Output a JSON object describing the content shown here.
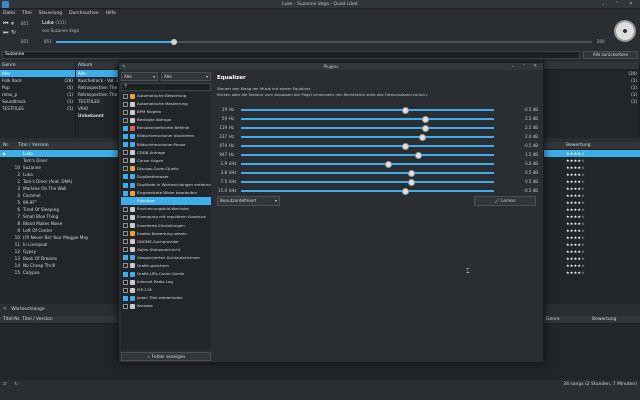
{
  "window": {
    "title": "Luke - Suzanne Vega - Quod Libet"
  },
  "menu": [
    "Datei",
    "Titel",
    "Steuerung",
    "Durchsuchen",
    "Hilfe"
  ],
  "player": {
    "volume_label": "851",
    "volume_value": "851",
    "title": "Luka",
    "title_extra": "(351)",
    "artist": "von Suzanne Vega",
    "time_current": "851",
    "time_total": "200",
    "progress": 0.22
  },
  "search": {
    "value": "Suzanne",
    "button_label": "Alle zurücksetzen"
  },
  "browser": {
    "genre_header": "Genre",
    "genres": [
      {
        "label": "Alle",
        "count": "",
        "selected": true
      },
      {
        "label": "Folk Rock",
        "count": "(28)"
      },
      {
        "label": "Pop",
        "count": "(5)"
      },
      {
        "label": "relax_p",
        "count": "(1)"
      },
      {
        "label": "Soundtrack",
        "count": "(1)"
      },
      {
        "label": "TESTFILES",
        "count": "(1)"
      }
    ],
    "album_header": "Album",
    "albums": [
      {
        "label": "Alle",
        "selected": true
      },
      {
        "label": "Kuschelrock - Vol. 23"
      },
      {
        "label": "Retrospective: The B"
      },
      {
        "label": "Retrospective: The B"
      },
      {
        "label": "TESTFILES"
      },
      {
        "label": "VAIO"
      },
      {
        "label": "Unbekannt",
        "bold": true
      }
    ],
    "right_counts": [
      "(30)",
      "(1)",
      "(1)",
      "(1)",
      "(1)"
    ]
  },
  "tracks": {
    "header_num": "Nr.",
    "header_title": "Titel / Version",
    "header_rating": "Bewertung",
    "rows": [
      {
        "num": "",
        "title": "Luka",
        "stars": "★★★★☆",
        "selected": true,
        "playing": true
      },
      {
        "num": "",
        "title": "Tom's Diner",
        "stars": "★★★★☆"
      },
      {
        "num": "10",
        "title": "Suzanne",
        "stars": "★★★★☆"
      },
      {
        "num": "2",
        "title": "Luka",
        "stars": "★★★★☆"
      },
      {
        "num": "2",
        "title": "Tom's Diner (feat. DNA)",
        "stars": "★★★★☆"
      },
      {
        "num": "3",
        "title": "Marlene On The Wall",
        "stars": "★★★★☆"
      },
      {
        "num": "4",
        "title": "Caramel",
        "stars": "★★★★☆"
      },
      {
        "num": "5",
        "title": "99.9F°",
        "stars": "★★★★☆"
      },
      {
        "num": "6",
        "title": "Tired Of Sleeping",
        "stars": "★★★★☆"
      },
      {
        "num": "7",
        "title": "Small Blue Thing",
        "stars": "★★★★☆"
      },
      {
        "num": "8",
        "title": "Blood Makes Noise",
        "stars": "★★★★☆"
      },
      {
        "num": "9",
        "title": "Left Of Center",
        "stars": "★★★★☆"
      },
      {
        "num": "10",
        "title": "(I'll Never Be) Your Maggie May",
        "stars": "★★★★☆"
      },
      {
        "num": "11",
        "title": "In Liverpool",
        "stars": "★★★★☆"
      },
      {
        "num": "12",
        "title": "Gypsy",
        "stars": "★★★★☆"
      },
      {
        "num": "13",
        "title": "Book Of Dreams",
        "stars": "★★★★☆"
      },
      {
        "num": "14",
        "title": "No Cheap Thrill",
        "stars": "★★★★☆"
      },
      {
        "num": "15",
        "title": "Calypso",
        "stars": "★★★★☆"
      }
    ]
  },
  "queue": {
    "label": "Warteschlange",
    "col_num": "Titel-Nr.",
    "col_title": "Titel / Version",
    "col_genre": "Genre",
    "col_rating": "Bewertung"
  },
  "status": {
    "text": "34 songs (2 Stunden, 7 Minuten)"
  },
  "dialog": {
    "title": "Plugins",
    "filter_left": "Alle",
    "filter_right": "Alle",
    "search_placeholder": "",
    "show_errors": "Fehler anzeigen",
    "plugins": [
      {
        "label": "Automatische Bewertung",
        "on": false,
        "color": "#e8a23c"
      },
      {
        "label": "Automatische Maskierung",
        "on": false,
        "color": "#cccccc"
      },
      {
        "label": "BPM Klopfen",
        "on": false,
        "color": "#cccccc"
      },
      {
        "label": "Bedingte Abfrage",
        "on": false,
        "color": "#cccccc"
      },
      {
        "label": "Benutzerdefinierte Befehle",
        "on": true,
        "color": "#e05a5a"
      },
      {
        "label": "Bildschirmschoner blockieren",
        "on": true,
        "color": "#3daee9"
      },
      {
        "label": "Bildschirmschoner-Pause",
        "on": true,
        "color": "#3daee9"
      },
      {
        "label": "CDDB-Anfrage",
        "on": false,
        "color": "#cccccc"
      },
      {
        "label": "Cursor folgen",
        "on": false,
        "color": "#cccccc"
      },
      {
        "label": "Discogs-Cover-Quelle",
        "on": false,
        "color": "#e8a23c"
      },
      {
        "label": "Duplikatbrowser",
        "on": true,
        "color": "#3daee9"
      },
      {
        "label": "Duplikate in Warteschlangen entfernen",
        "on": true,
        "color": "#3daee9"
      },
      {
        "label": "Eingebettete Bilder bearbeiten",
        "on": true,
        "color": "#e8a23c"
      },
      {
        "label": "Equalizer",
        "on": true,
        "color": "#3daee9",
        "selected": true
      },
      {
        "label": "Erscheinungsbild-Wechsler",
        "on": false,
        "color": "#cccccc"
      },
      {
        "label": "Erzeugung mit regulärem Ausdruck",
        "on": false,
        "color": "#cccccc"
      },
      {
        "label": "Erweiterte Einstellungen",
        "on": false,
        "color": "#cccccc"
      },
      {
        "label": "Exakte Bewertung setzen",
        "on": false,
        "color": "#e8a23c"
      },
      {
        "label": "GNOME-Suchprovider",
        "on": false,
        "color": "#cccccc"
      },
      {
        "label": "Gajim-Statusnachricht",
        "on": false,
        "color": "#cccccc"
      },
      {
        "label": "Gespeicherten Suchaufzeichnen",
        "on": true,
        "color": "#3daee9"
      },
      {
        "label": "Grafik speichern",
        "on": false,
        "color": "#cccccc"
      },
      {
        "label": "Grafik-URL-Cover-Quelle",
        "on": true,
        "color": "#3daee9"
      },
      {
        "label": "Internet Radio Log",
        "on": false,
        "color": "#cccccc"
      },
      {
        "label": "ISP-118",
        "on": false,
        "color": "#cccccc"
      },
      {
        "label": "Jeden Titel wiederholen",
        "on": true,
        "color": "#3daee9"
      },
      {
        "label": "Karaoke",
        "on": false,
        "color": "#cccccc"
      }
    ],
    "equalizer": {
      "title": "Equalizer",
      "desc1": "Steuert den Klang der Musik mit einem Equalizer.",
      "desc2": "Klicken oder die Tastatur zum Anpassen der Pegel verwenden (ein Rechtsklick setzt das Frequenzband zurück).",
      "preset_label": "Benutzerdefiniert",
      "learn_label": "Lernen",
      "range_min": -24,
      "range_max": 12,
      "bands": [
        {
          "freq": "29",
          "unit": "Hz",
          "value_text": "-0.5 dB",
          "level": -0.5
        },
        {
          "freq": "59",
          "unit": "Hz",
          "value_text": "2.5 dB",
          "level": 2.5
        },
        {
          "freq": "119",
          "unit": "Hz",
          "value_text": "2.5 dB",
          "level": 2.5
        },
        {
          "freq": "237",
          "unit": "Hz",
          "value_text": "2.0 dB",
          "level": 2.0
        },
        {
          "freq": "474",
          "unit": "Hz",
          "value_text": "-0.5 dB",
          "level": -0.5
        },
        {
          "freq": "947",
          "unit": "Hz",
          "value_text": "1.5 dB",
          "level": 1.5
        },
        {
          "freq": "1.9",
          "unit": "kHz",
          "value_text": "-3.0 dB",
          "level": -3.0
        },
        {
          "freq": "3.8",
          "unit": "kHz",
          "value_text": "0.5 dB",
          "level": 0.5
        },
        {
          "freq": "7.5",
          "unit": "kHz",
          "value_text": "0.5 dB",
          "level": 0.5
        },
        {
          "freq": "15.0",
          "unit": "kHz",
          "value_text": "-0.5 dB",
          "level": -0.5
        }
      ]
    }
  }
}
